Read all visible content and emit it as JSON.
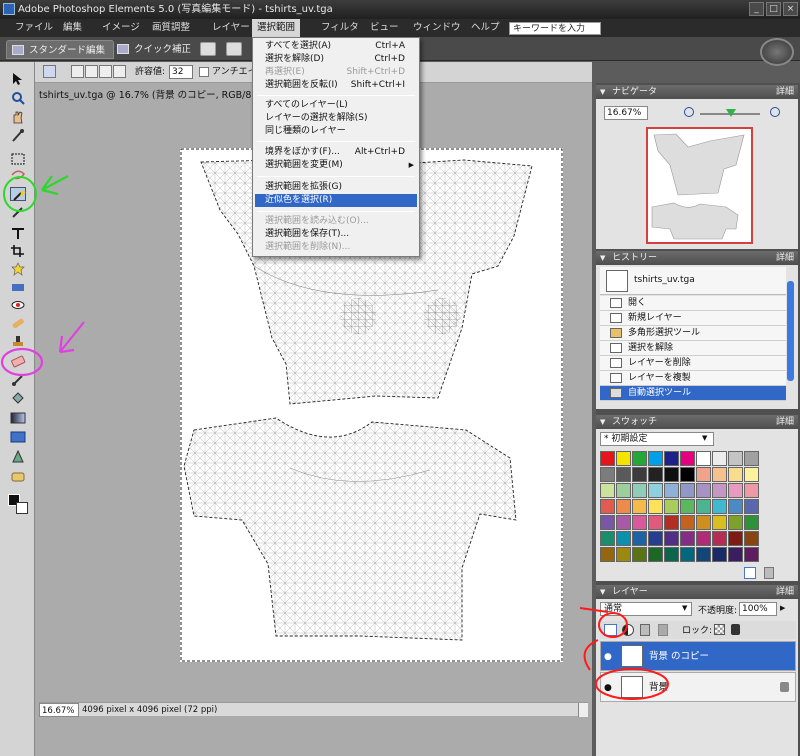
{
  "window": {
    "title": "Adobe Photoshop Elements 5.0 (写真編集モード) - tshirts_uv.tga",
    "buttons": [
      "_",
      "□",
      "×"
    ]
  },
  "menubar": {
    "items": [
      "ファイル",
      "編集",
      "イメージ",
      "画質調整",
      "レイヤー",
      "選択範囲",
      "フィルタ",
      "ビュー",
      "ウィンドウ",
      "ヘルプ"
    ],
    "active": "選択範囲",
    "keyword_placeholder": "キーワードを入力"
  },
  "modebar": {
    "standard_tab": "スタンダード編集",
    "quick_tab": "クイック補正"
  },
  "options": {
    "tolerance_label": "許容値:",
    "tolerance_value": "32",
    "antialias_label": "アンチエイリア"
  },
  "document": {
    "title": "tshirts_uv.tga @ 16.7% (背景 のコピー, RGB/8)",
    "zoom": "16.67%",
    "info": "4096 pixel x 4096 pixel (72 ppi)"
  },
  "select_menu": {
    "items": [
      {
        "label": "すべてを選択(A)",
        "shortcut": "Ctrl+A",
        "state": "normal"
      },
      {
        "label": "選択を解除(D)",
        "shortcut": "Ctrl+D",
        "state": "normal"
      },
      {
        "label": "再選択(E)",
        "shortcut": "Shift+Ctrl+D",
        "state": "disabled"
      },
      {
        "label": "選択範囲を反転(I)",
        "shortcut": "Shift+Ctrl+I",
        "state": "normal"
      },
      {
        "label": "すべてのレイヤー(L)",
        "shortcut": "",
        "state": "normal"
      },
      {
        "label": "レイヤーの選択を解除(S)",
        "shortcut": "",
        "state": "normal"
      },
      {
        "label": "同じ種類のレイヤー",
        "shortcut": "",
        "state": "normal"
      },
      {
        "label": "境界をぼかす(F)...",
        "shortcut": "Alt+Ctrl+D",
        "state": "normal"
      },
      {
        "label": "選択範囲を変更(M)",
        "shortcut": "",
        "state": "submenu"
      },
      {
        "label": "選択範囲を拡張(G)",
        "shortcut": "",
        "state": "normal"
      },
      {
        "label": "近似色を選択(R)",
        "shortcut": "",
        "state": "highlighted"
      },
      {
        "label": "選択範囲を読み込む(O)...",
        "shortcut": "",
        "state": "disabled"
      },
      {
        "label": "選択範囲を保存(T)...",
        "shortcut": "",
        "state": "normal"
      },
      {
        "label": "選択範囲を削除(N)...",
        "shortcut": "",
        "state": "disabled"
      }
    ]
  },
  "navigator": {
    "title": "ナビゲータ",
    "more": "詳細",
    "zoom": "16.67%"
  },
  "history": {
    "title": "ヒストリー",
    "more": "詳細",
    "snapshot": "tshirts_uv.tga",
    "steps": [
      "開く",
      "新規レイヤー",
      "多角形選択ツール",
      "選択を解除",
      "レイヤーを削除",
      "レイヤーを複製",
      "自動選択ツール"
    ],
    "active_step": "自動選択ツール"
  },
  "swatches": {
    "title": "スウォッチ",
    "more": "詳細",
    "preset": "* 初期設定",
    "colors": [
      "#e6151a",
      "#f3e500",
      "#24a739",
      "#00a0e9",
      "#1d2088",
      "#e4007f",
      "#ffffff",
      "#ececec",
      "#c4c4c4",
      "#a0a0a0",
      "#7c7c7c",
      "#5a5a5a",
      "#3c3c3c",
      "#222222",
      "#0f0f0f",
      "#000000",
      "#f0a28b",
      "#f7c08f",
      "#f9dd8f",
      "#fbf29b",
      "#cbe39a",
      "#9ccf9b",
      "#8fcdb6",
      "#8fd0e0",
      "#8fb1d9",
      "#9098c8",
      "#a891c3",
      "#c598c4",
      "#e89bc0",
      "#ed9aa4",
      "#e35a4f",
      "#ee8a4a",
      "#f5b94c",
      "#fbe25a",
      "#a8cd5d",
      "#5cb85f",
      "#4bb491",
      "#40b8d0",
      "#4b8ac4",
      "#5967b0",
      "#7a57a5",
      "#a85aa4",
      "#d95a9b",
      "#e05a7c",
      "#b32e22",
      "#c4631f",
      "#cf8f1f",
      "#d8be1e",
      "#7da22a",
      "#2e9238",
      "#1b8d6d",
      "#0b91ad",
      "#1d63a3",
      "#283e8f",
      "#532e86",
      "#842d84",
      "#b12c76",
      "#b52d55",
      "#7e1c13",
      "#8a4410",
      "#946610",
      "#9c880e",
      "#587416",
      "#1e6826",
      "#0c664c",
      "#03687e",
      "#134676",
      "#1a2a67",
      "#3a1e61",
      "#5f1c5e"
    ]
  },
  "layers": {
    "title": "レイヤー",
    "more": "詳細",
    "blend_mode": "通常",
    "opacity_label": "不透明度:",
    "opacity_value": "100%",
    "lock_label": "ロック:",
    "items": [
      {
        "name": "背景 のコピー",
        "selected": true,
        "locked": false
      },
      {
        "name": "背景",
        "selected": false,
        "locked": true
      }
    ]
  },
  "accent": {
    "selection_blue": "#3168c8",
    "annotation_green": "#2cd82c",
    "annotation_magenta": "#e040e0",
    "annotation_red": "#ff1a1a"
  }
}
